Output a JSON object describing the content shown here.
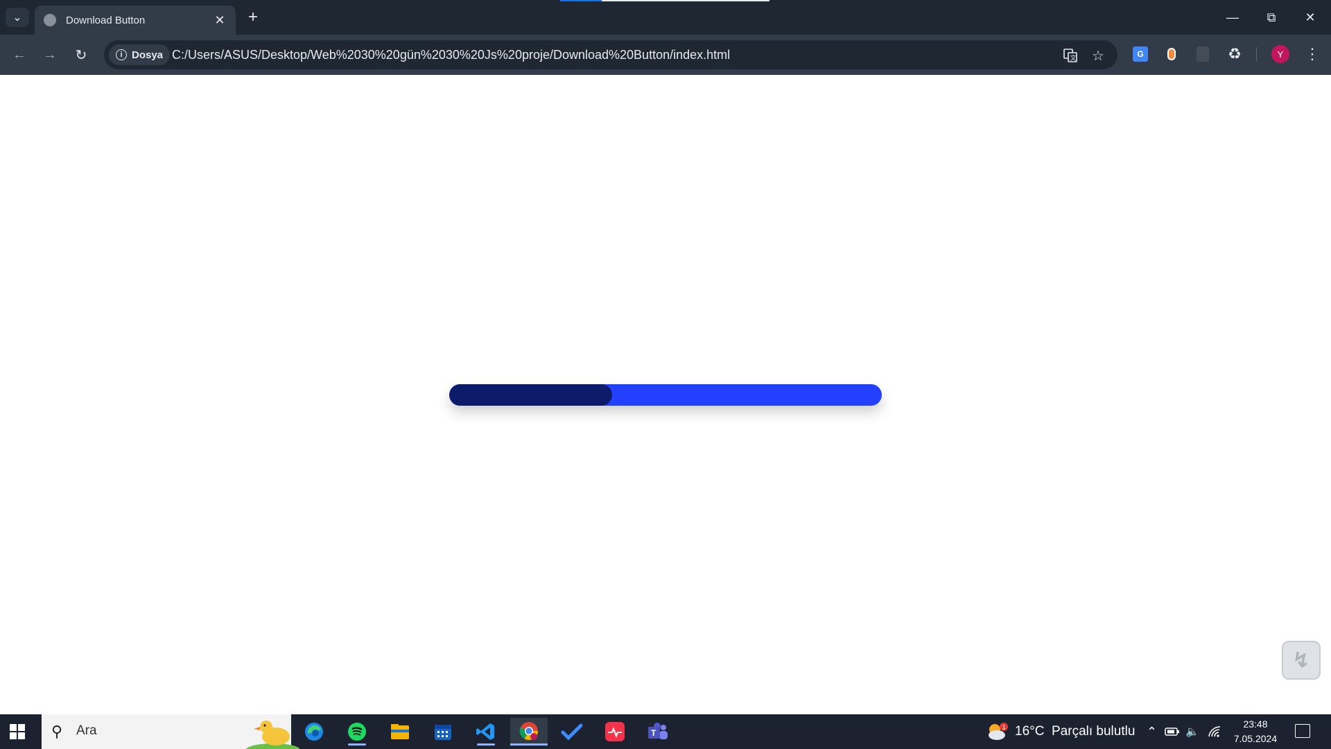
{
  "browser": {
    "tab_title": "Download Button",
    "site_chip": "Dosya",
    "url": "C:/Users/ASUS/Desktop/Web%2030%20gün%2030%20Js%20proje/Download%20Button/index.html",
    "profile_initial": "Y",
    "translate_ext_label": "G"
  },
  "page": {
    "progress_fraction": 0.376,
    "track_color": "#2440ff",
    "fill_color": "#0d1b6b"
  },
  "taskbar": {
    "search_placeholder": "Ara",
    "weather": "16°C  Parçalı bulutlu",
    "weather_badge": "1",
    "time": "23:48",
    "date": "7.05.2024",
    "apps": [
      "edge-icon",
      "spotify-icon",
      "file-explorer-icon",
      "calendar-icon",
      "vscode-icon",
      "chrome-icon",
      "todo-icon",
      "cardiogram-icon",
      "teams-icon"
    ]
  }
}
